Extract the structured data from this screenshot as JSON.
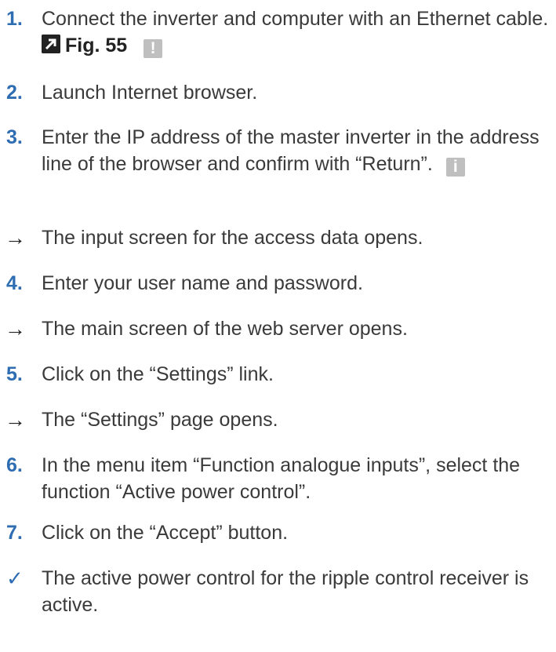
{
  "steps": [
    {
      "kind": "step",
      "number": "1.",
      "text": "Connect the inverter and computer with an Ethernet cable.",
      "ref_label": "Fig. 55",
      "link_icon": "arrow-up-right-icon",
      "after_icon": "warning-icon"
    },
    {
      "kind": "step",
      "number": "2.",
      "text": "Launch Internet browser."
    },
    {
      "kind": "step",
      "number": "3.",
      "text": "Enter the IP address of the master inverter in the address line of the browser and confirm with “Return”.",
      "after_icon": "info-icon"
    },
    {
      "kind": "result",
      "glyph": "→",
      "text": "The input screen for the access data opens."
    },
    {
      "kind": "step",
      "number": "4.",
      "text": "Enter your user name and password."
    },
    {
      "kind": "result",
      "glyph": "→",
      "text": "The main screen of the web server opens."
    },
    {
      "kind": "step",
      "number": "5.",
      "text": "Click on the “Settings” link."
    },
    {
      "kind": "result",
      "glyph": "→",
      "text": "The “Settings” page opens."
    },
    {
      "kind": "step",
      "number": "6.",
      "text": "In the menu item “Function analogue inputs”, select the function “Active power control”."
    },
    {
      "kind": "step",
      "number": "7.",
      "text": "Click on the “Accept” button."
    },
    {
      "kind": "done",
      "glyph": "✓",
      "text": "The active power control for the ripple control receiver is active."
    }
  ],
  "colors": {
    "step_number": "#2e6db2",
    "body_text": "#3a3a3a",
    "icon_box": "#bfbfbf"
  }
}
